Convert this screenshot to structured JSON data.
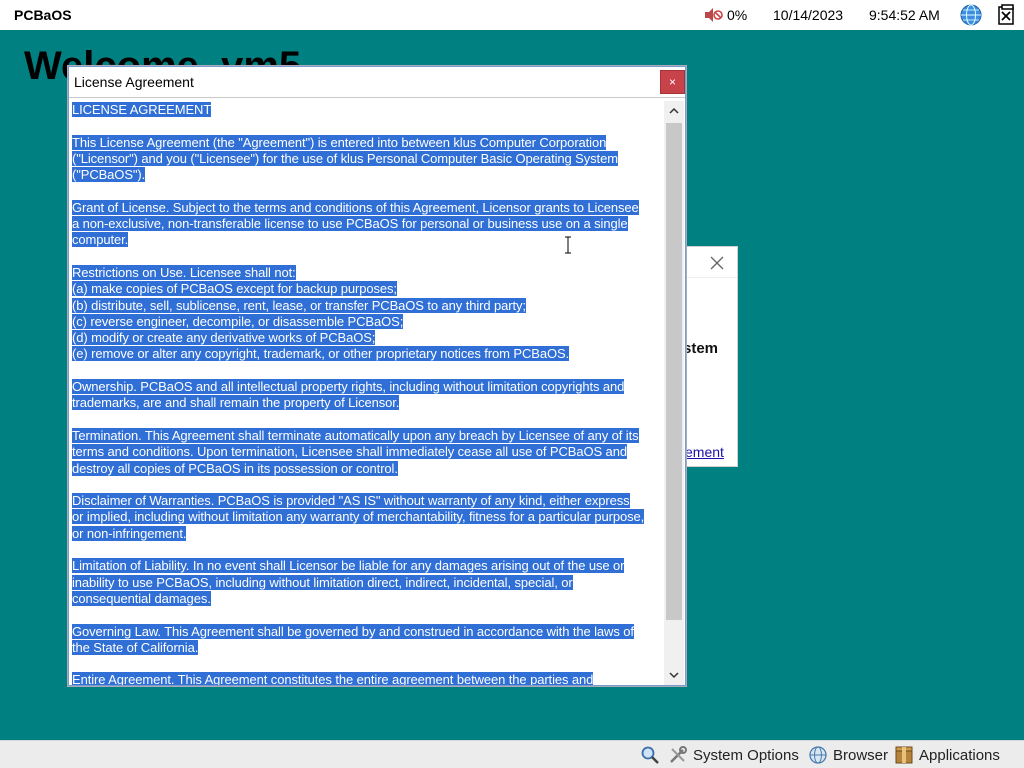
{
  "topbar": {
    "os_name": "PCBaOS",
    "volume_icon": "muted-speaker-icon",
    "volume_level": "0%",
    "date": "10/14/2023",
    "time": "9:54:52 AM",
    "globe_icon": "globe-icon",
    "logout_icon": "logout-icon"
  },
  "desktop": {
    "welcome_text": "Welcome, vm5"
  },
  "background_dialog": {
    "title_fragment": "stem",
    "link_fragment": "ement"
  },
  "license_dialog": {
    "title": "License Agreement",
    "close_label": "×",
    "paragraphs": [
      [
        "LICENSE AGREEMENT"
      ],
      [
        "This License Agreement (the \"Agreement\") is entered into between klus Computer Corporation",
        "(\"Licensor\") and you (\"Licensee\") for the use of klus Personal Computer Basic Operating System",
        "(\"PCBaOS\")."
      ],
      [
        "Grant of License. Subject to the terms and conditions of this Agreement, Licensor grants to Licensee",
        "a non-exclusive, non-transferable license to use PCBaOS for personal or business use on a single",
        "computer."
      ],
      [
        "Restrictions on Use. Licensee shall not:",
        "(a) make copies of PCBaOS except for backup purposes;",
        "(b) distribute, sell, sublicense, rent, lease, or transfer PCBaOS to any third party;",
        "(c) reverse engineer, decompile, or disassemble PCBaOS;",
        "(d) modify or create any derivative works of PCBaOS;",
        "(e) remove or alter any copyright, trademark, or other proprietary notices from PCBaOS."
      ],
      [
        "Ownership. PCBaOS and all intellectual property rights, including without limitation copyrights and",
        "trademarks, are and shall remain the property of Licensor."
      ],
      [
        "Termination. This Agreement shall terminate automatically upon any breach by Licensee of any of its",
        "terms and conditions. Upon termination, Licensee shall immediately cease all use of PCBaOS and",
        "destroy all copies of PCBaOS in its possession or control."
      ],
      [
        "Disclaimer of Warranties. PCBaOS is provided \"AS IS\" without warranty of any kind, either express",
        "or implied, including without limitation any warranty of merchantability, fitness for a particular purpose,",
        "or non-infringement."
      ],
      [
        "Limitation of Liability. In no event shall Licensor be liable for any damages arising out of the use or",
        "inability to use PCBaOS, including without limitation direct, indirect, incidental, special, or",
        "consequential damages."
      ],
      [
        "Governing Law. This Agreement shall be governed by and construed in accordance with the laws of",
        "the State of California."
      ],
      [
        "Entire Agreement. This Agreement constitutes the entire agreement between the parties and"
      ]
    ]
  },
  "taskbar": {
    "search_icon": "magnifier-icon",
    "system_options_label": "System Options",
    "browser_label": "Browser",
    "applications_label": "Applications"
  },
  "colors": {
    "desktop_bg": "#008080",
    "selection": "#2f6fd6",
    "close_button": "#c8424a"
  }
}
